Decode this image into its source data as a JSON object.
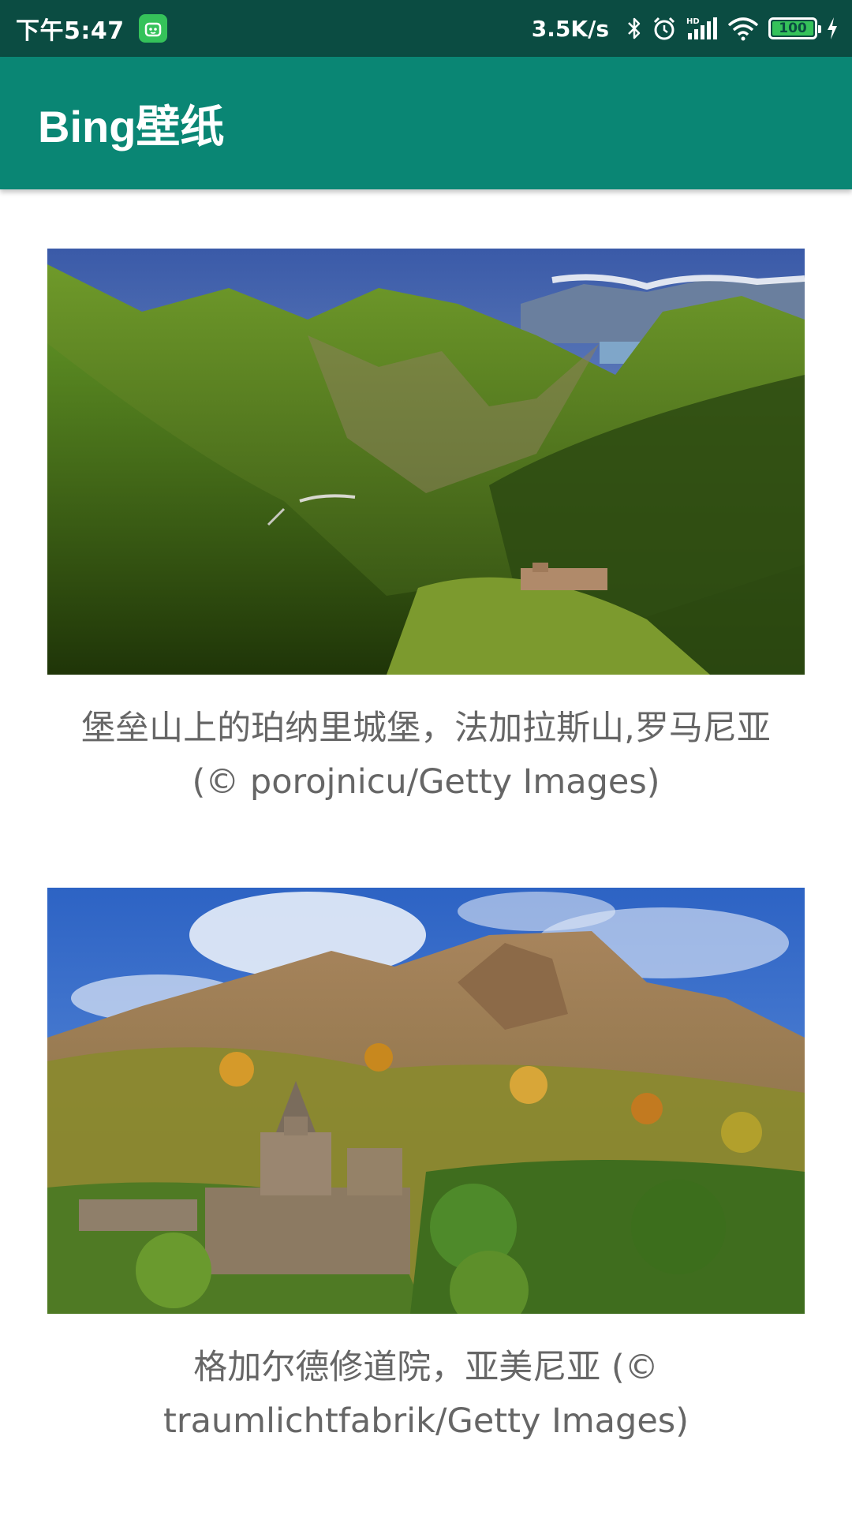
{
  "status_bar": {
    "time": "下午5:47",
    "network_speed": "3.5K/s",
    "battery_level": "100",
    "icons": [
      "app-notification-icon",
      "bluetooth-icon",
      "alarm-icon",
      "hd-signal-icon",
      "wifi-icon",
      "battery-icon",
      "charging-icon"
    ]
  },
  "app_bar": {
    "title": "Bing壁纸"
  },
  "colors": {
    "status_bar": "#0b4c42",
    "app_bar": "#0a8674",
    "caption_text": "#666666",
    "background": "#ffffff"
  },
  "wallpapers": [
    {
      "caption": "堡垒山上的珀纳里城堡，法加拉斯山,罗马尼亚 (© porojnicu/Getty Images)",
      "image": "mountain-valley-castle-photo"
    },
    {
      "caption": "格加尔德修道院，亚美尼亚 (© traumlichtfabrik/Getty Images)",
      "image": "monastery-mountain-photo"
    }
  ]
}
